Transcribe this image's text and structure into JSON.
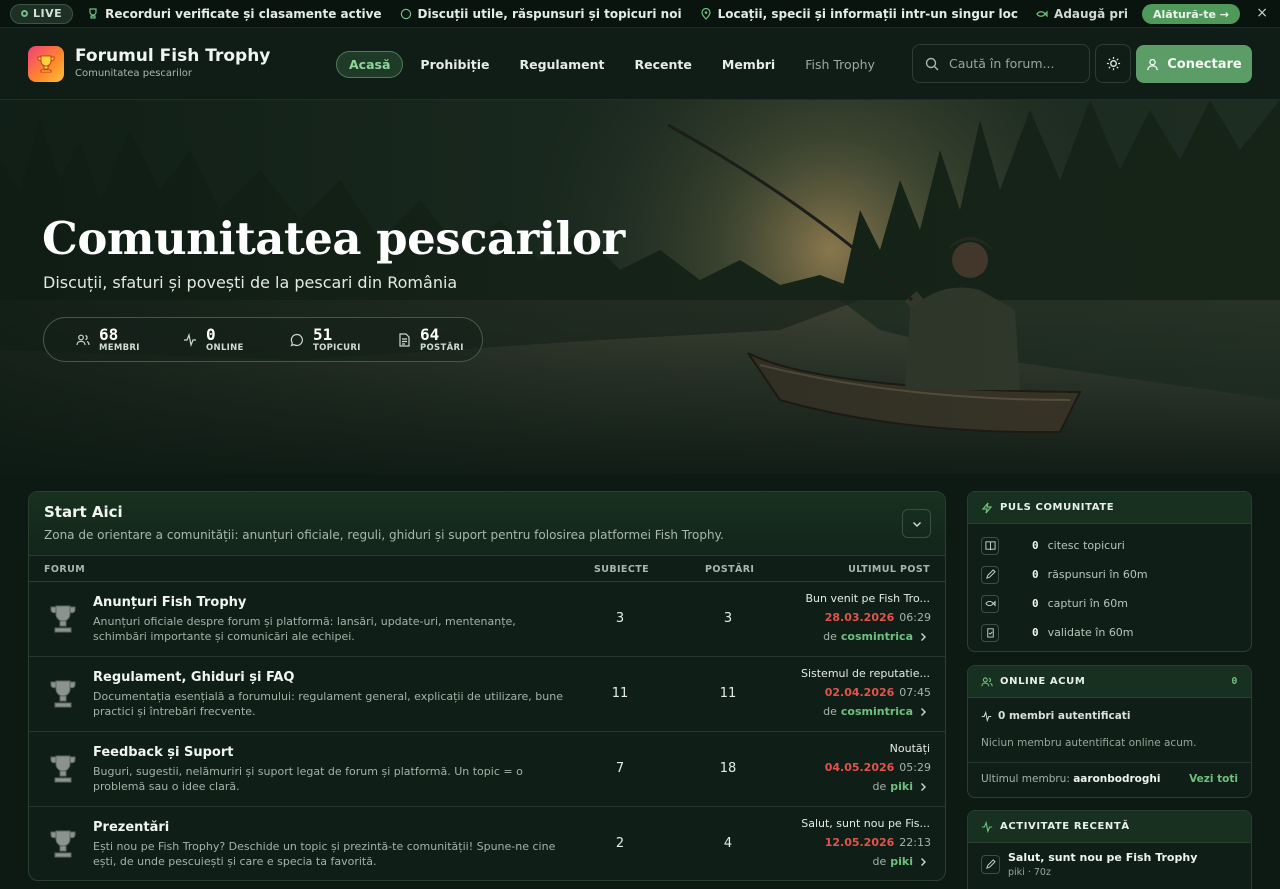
{
  "ticker": {
    "live_label": "LIVE",
    "items": [
      {
        "icon": "trophy-icon",
        "text": "Recorduri verificate și clasamente active"
      },
      {
        "icon": "chat-bubble-icon",
        "text": "Discuții utile, răspunsuri și topicuri noi"
      },
      {
        "icon": "map-pin-icon",
        "text": "Locații, specii și informații intr-un singur loc"
      },
      {
        "icon": "fish-icon",
        "text": "Adaugă prima ta captură în m"
      }
    ],
    "join_label": "Alătură-te →",
    "close_label": "×"
  },
  "header": {
    "site_title": "Forumul Fish Trophy",
    "site_subtitle": "Comunitatea pescarilor",
    "nav": [
      {
        "label": "Acasă",
        "active": true
      },
      {
        "label": "Prohibiție"
      },
      {
        "label": "Regulament"
      },
      {
        "label": "Recente"
      },
      {
        "label": "Membri"
      },
      {
        "label": "Fish Trophy",
        "muted": true
      }
    ],
    "search_placeholder": "Caută în forum...",
    "login_label": "Conectare"
  },
  "hero": {
    "title": "Comunitatea pescarilor",
    "subtitle": "Discuții, sfaturi și povești de la pescari din România",
    "stats": [
      {
        "icon": "users-icon",
        "value": "68",
        "label": "MEMBRI"
      },
      {
        "icon": "activity-icon",
        "value": "0",
        "label": "ONLINE"
      },
      {
        "icon": "chat-bubble-icon",
        "value": "51",
        "label": "TOPICURI"
      },
      {
        "icon": "document-icon",
        "value": "64",
        "label": "POSTĂRI"
      }
    ]
  },
  "forum_section": {
    "title": "Start Aici",
    "description": "Zona de orientare a comunității: anunțuri oficiale, reguli, ghiduri și suport pentru folosirea platformei Fish Trophy.",
    "columns": {
      "forum": "FORUM",
      "subjects": "SUBIECTE",
      "posts": "POSTĂRI",
      "last_post": "ULTIMUL POST"
    },
    "forums": [
      {
        "name": "Anunțuri Fish Trophy",
        "description": "Anunțuri oficiale despre forum și platformă: lansări, update-uri, mentenanțe, schimbări importante și comunicări ale echipei.",
        "subjects": "3",
        "posts": "3",
        "last_title": "Bun venit pe Fish Tro...",
        "last_date": "28.03.2026",
        "last_time": "06:29",
        "by_label": "de",
        "last_user": "cosmintrica"
      },
      {
        "name": "Regulament, Ghiduri și FAQ",
        "description": "Documentația esențială a forumului: regulament general, explicații de utilizare, bune practici și întrebări frecvente.",
        "subjects": "11",
        "posts": "11",
        "last_title": "Sistemul de reputatie...",
        "last_date": "02.04.2026",
        "last_time": "07:45",
        "by_label": "de",
        "last_user": "cosmintrica"
      },
      {
        "name": "Feedback și Suport",
        "description": "Buguri, sugestii, nelămuriri și suport legat de forum și platformă. Un topic = o problemă sau o idee clară.",
        "subjects": "7",
        "posts": "18",
        "last_title": "Noutăți",
        "last_date": "04.05.2026",
        "last_time": "05:29",
        "by_label": "de",
        "last_user": "piki"
      },
      {
        "name": "Prezentări",
        "description": "Ești nou pe Fish Trophy? Deschide un topic și prezintă-te comunității! Spune-ne cine ești, de unde pescuiești și care e specia ta favorită.",
        "subjects": "2",
        "posts": "4",
        "last_title": "Salut, sunt nou pe Fis...",
        "last_date": "12.05.2026",
        "last_time": "22:13",
        "by_label": "de",
        "last_user": "piki"
      }
    ]
  },
  "sidebar": {
    "pulse": {
      "title": "PULS COMUNITATE",
      "rows": [
        {
          "icon": "book-icon",
          "value": "0",
          "label": "citesc topicuri"
        },
        {
          "icon": "pencil-icon",
          "value": "0",
          "label": "răspunsuri în 60m"
        },
        {
          "icon": "fish-icon",
          "value": "0",
          "label": "capturi în 60m"
        },
        {
          "icon": "clipboard-check-icon",
          "value": "0",
          "label": "validate în 60m"
        }
      ]
    },
    "online": {
      "title": "ONLINE ACUM",
      "count": "0",
      "authenticated": "0 membri autentificati",
      "empty": "Niciun membru autentificat online acum.",
      "last_member_label": "Ultimul membru:",
      "last_member": "aaronbodroghi",
      "see_all": "Vezi toti"
    },
    "activity": {
      "title": "ACTIVITATE RECENTĂ",
      "items": [
        {
          "title": "Salut, sunt nou pe Fish Trophy",
          "meta": "piki · 70z"
        }
      ]
    }
  },
  "colors": {
    "accent": "#5c9c66",
    "accent_text": "#6fbf7f",
    "date_red": "#e3534b",
    "background": "#0c1a13"
  }
}
